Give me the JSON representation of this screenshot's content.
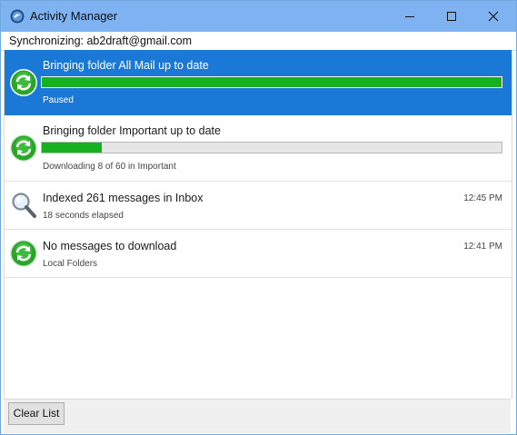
{
  "window": {
    "title": "Activity Manager",
    "titlebar_color": "#7fb2f0",
    "icons": [
      "thunderbird-app-icon",
      "minimize-icon",
      "maximize-icon",
      "close-icon"
    ]
  },
  "sync": {
    "label": "Synchronizing: ab2draft@gmail.com"
  },
  "activities": [
    {
      "title": "Bringing folder All Mail up to date",
      "status": "Paused",
      "icon": "sync-icon",
      "progress": 1.0,
      "selected": true
    },
    {
      "title": "Bringing folder Important up to date",
      "status": "Downloading 8 of 60 in Important",
      "icon": "sync-icon",
      "progress": 0.13,
      "selected": false
    },
    {
      "title": "Indexed 261 messages in Inbox",
      "status": "18 seconds elapsed",
      "time": "12:45 PM",
      "icon": "magnifier-icon"
    },
    {
      "title": "No messages to download",
      "status": "Local Folders",
      "time": "12:41 PM",
      "icon": "sync-icon"
    }
  ],
  "colors": {
    "selected_row": "#1a78d6",
    "progress_fill": "#16b120"
  },
  "footer": {
    "clear_label": "Clear List"
  }
}
